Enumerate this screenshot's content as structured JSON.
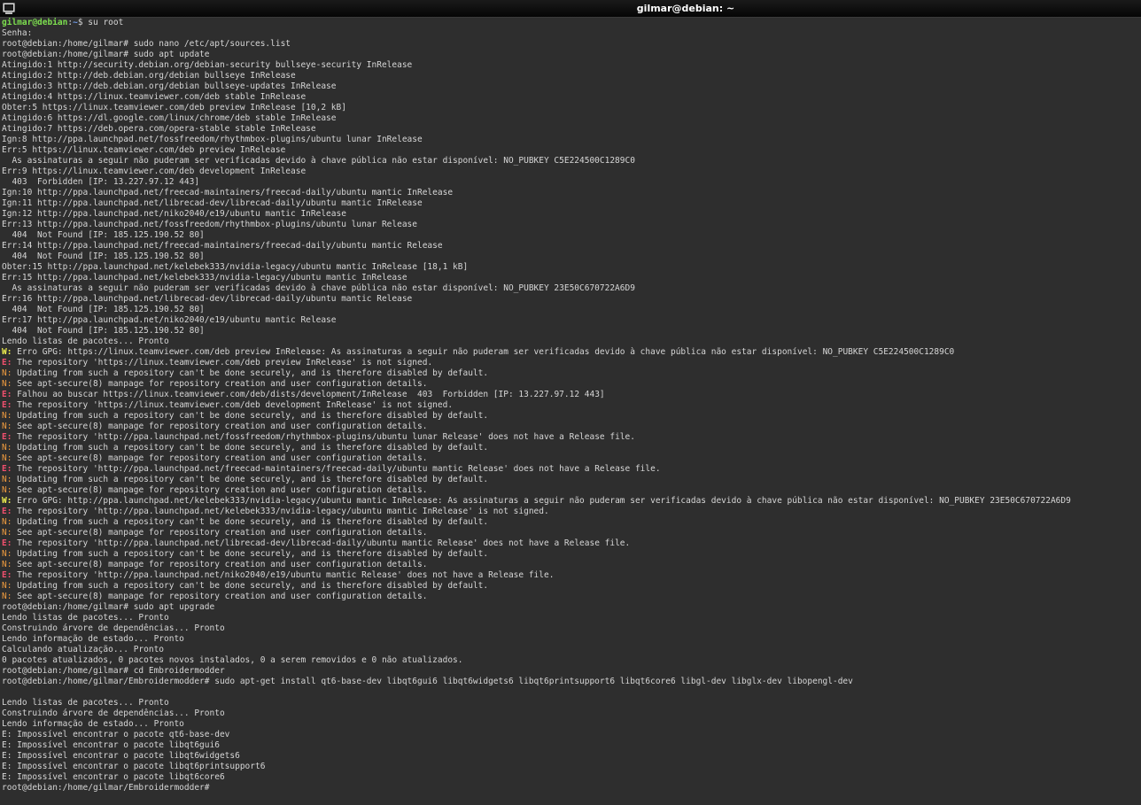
{
  "window": {
    "title": "gilmar@debian: ~"
  },
  "icons": {
    "app_icon": "terminal-icon"
  },
  "colors": {
    "background": "#2e2e2e",
    "text": "#d6d6d6",
    "prompt_user": "#7ddf4f",
    "prompt_path": "#6f9be8",
    "warning_prefix": "#f2f24f",
    "error_prefix": "#f0506e",
    "notice_prefix": "#ef9b3f"
  },
  "prompt": {
    "user_host": "gilmar@debian",
    "separator": ":",
    "path": "~",
    "symbol": "$ ",
    "command": "su root"
  },
  "lines": [
    {
      "t": "Senha:"
    },
    {
      "t": "root@debian:/home/gilmar# sudo nano /etc/apt/sources.list"
    },
    {
      "t": "root@debian:/home/gilmar# sudo apt update"
    },
    {
      "t": "Atingido:1 http://security.debian.org/debian-security bullseye-security InRelease"
    },
    {
      "t": "Atingido:2 http://deb.debian.org/debian bullseye InRelease"
    },
    {
      "t": "Atingido:3 http://deb.debian.org/debian bullseye-updates InRelease"
    },
    {
      "t": "Atingido:4 https://linux.teamviewer.com/deb stable InRelease"
    },
    {
      "t": "Obter:5 https://linux.teamviewer.com/deb preview InRelease [10,2 kB]"
    },
    {
      "t": "Atingido:6 https://dl.google.com/linux/chrome/deb stable InRelease"
    },
    {
      "t": "Atingido:7 https://deb.opera.com/opera-stable stable InRelease"
    },
    {
      "t": "Ign:8 http://ppa.launchpad.net/fossfreedom/rhythmbox-plugins/ubuntu lunar InRelease"
    },
    {
      "t": "Err:5 https://linux.teamviewer.com/deb preview InRelease"
    },
    {
      "t": "  As assinaturas a seguir não puderam ser verificadas devido à chave pública não estar disponível: NO_PUBKEY C5E224500C1289C0"
    },
    {
      "t": "Err:9 https://linux.teamviewer.com/deb development InRelease"
    },
    {
      "t": "  403  Forbidden [IP: 13.227.97.12 443]"
    },
    {
      "t": "Ign:10 http://ppa.launchpad.net/freecad-maintainers/freecad-daily/ubuntu mantic InRelease"
    },
    {
      "t": "Ign:11 http://ppa.launchpad.net/librecad-dev/librecad-daily/ubuntu mantic InRelease"
    },
    {
      "t": "Ign:12 http://ppa.launchpad.net/niko2040/e19/ubuntu mantic InRelease"
    },
    {
      "t": "Err:13 http://ppa.launchpad.net/fossfreedom/rhythmbox-plugins/ubuntu lunar Release"
    },
    {
      "t": "  404  Not Found [IP: 185.125.190.52 80]"
    },
    {
      "t": "Err:14 http://ppa.launchpad.net/freecad-maintainers/freecad-daily/ubuntu mantic Release"
    },
    {
      "t": "  404  Not Found [IP: 185.125.190.52 80]"
    },
    {
      "t": "Obter:15 http://ppa.launchpad.net/kelebek333/nvidia-legacy/ubuntu mantic InRelease [18,1 kB]"
    },
    {
      "t": "Err:15 http://ppa.launchpad.net/kelebek333/nvidia-legacy/ubuntu mantic InRelease"
    },
    {
      "t": "  As assinaturas a seguir não puderam ser verificadas devido à chave pública não estar disponível: NO_PUBKEY 23E50C670722A6D9"
    },
    {
      "t": "Err:16 http://ppa.launchpad.net/librecad-dev/librecad-daily/ubuntu mantic Release"
    },
    {
      "t": "  404  Not Found [IP: 185.125.190.52 80]"
    },
    {
      "t": "Err:17 http://ppa.launchpad.net/niko2040/e19/ubuntu mantic Release"
    },
    {
      "t": "  404  Not Found [IP: 185.125.190.52 80]"
    },
    {
      "t": "Lendo listas de pacotes... Pronto"
    },
    {
      "p": "W:",
      "k": "w",
      "t": " Erro GPG: https://linux.teamviewer.com/deb preview InRelease: As assinaturas a seguir não puderam ser verificadas devido à chave pública não estar disponível: NO_PUBKEY C5E224500C1289C0"
    },
    {
      "p": "E:",
      "k": "e",
      "t": " The repository 'https://linux.teamviewer.com/deb preview InRelease' is not signed."
    },
    {
      "p": "N:",
      "k": "n",
      "t": " Updating from such a repository can't be done securely, and is therefore disabled by default."
    },
    {
      "p": "N:",
      "k": "n",
      "t": " See apt-secure(8) manpage for repository creation and user configuration details."
    },
    {
      "p": "E:",
      "k": "e",
      "t": " Falhou ao buscar https://linux.teamviewer.com/deb/dists/development/InRelease  403  Forbidden [IP: 13.227.97.12 443]"
    },
    {
      "p": "E:",
      "k": "e",
      "t": " The repository 'https://linux.teamviewer.com/deb development InRelease' is not signed."
    },
    {
      "p": "N:",
      "k": "n",
      "t": " Updating from such a repository can't be done securely, and is therefore disabled by default."
    },
    {
      "p": "N:",
      "k": "n",
      "t": " See apt-secure(8) manpage for repository creation and user configuration details."
    },
    {
      "p": "E:",
      "k": "e",
      "t": " The repository 'http://ppa.launchpad.net/fossfreedom/rhythmbox-plugins/ubuntu lunar Release' does not have a Release file."
    },
    {
      "p": "N:",
      "k": "n",
      "t": " Updating from such a repository can't be done securely, and is therefore disabled by default."
    },
    {
      "p": "N:",
      "k": "n",
      "t": " See apt-secure(8) manpage for repository creation and user configuration details."
    },
    {
      "p": "E:",
      "k": "e",
      "t": " The repository 'http://ppa.launchpad.net/freecad-maintainers/freecad-daily/ubuntu mantic Release' does not have a Release file."
    },
    {
      "p": "N:",
      "k": "n",
      "t": " Updating from such a repository can't be done securely, and is therefore disabled by default."
    },
    {
      "p": "N:",
      "k": "n",
      "t": " See apt-secure(8) manpage for repository creation and user configuration details."
    },
    {
      "p": "W:",
      "k": "w",
      "t": " Erro GPG: http://ppa.launchpad.net/kelebek333/nvidia-legacy/ubuntu mantic InRelease: As assinaturas a seguir não puderam ser verificadas devido à chave pública não estar disponível: NO_PUBKEY 23E50C670722A6D9"
    },
    {
      "p": "E:",
      "k": "e",
      "t": " The repository 'http://ppa.launchpad.net/kelebek333/nvidia-legacy/ubuntu mantic InRelease' is not signed."
    },
    {
      "p": "N:",
      "k": "n",
      "t": " Updating from such a repository can't be done securely, and is therefore disabled by default."
    },
    {
      "p": "N:",
      "k": "n",
      "t": " See apt-secure(8) manpage for repository creation and user configuration details."
    },
    {
      "p": "E:",
      "k": "e",
      "t": " The repository 'http://ppa.launchpad.net/librecad-dev/librecad-daily/ubuntu mantic Release' does not have a Release file."
    },
    {
      "p": "N:",
      "k": "n",
      "t": " Updating from such a repository can't be done securely, and is therefore disabled by default."
    },
    {
      "p": "N:",
      "k": "n",
      "t": " See apt-secure(8) manpage for repository creation and user configuration details."
    },
    {
      "p": "E:",
      "k": "e",
      "t": " The repository 'http://ppa.launchpad.net/niko2040/e19/ubuntu mantic Release' does not have a Release file."
    },
    {
      "p": "N:",
      "k": "n",
      "t": " Updating from such a repository can't be done securely, and is therefore disabled by default."
    },
    {
      "p": "N:",
      "k": "n",
      "t": " See apt-secure(8) manpage for repository creation and user configuration details."
    },
    {
      "t": "root@debian:/home/gilmar# sudo apt upgrade"
    },
    {
      "t": "Lendo listas de pacotes... Pronto"
    },
    {
      "t": "Construindo árvore de dependências... Pronto"
    },
    {
      "t": "Lendo informação de estado... Pronto"
    },
    {
      "t": "Calculando atualização... Pronto"
    },
    {
      "t": "0 pacotes atualizados, 0 pacotes novos instalados, 0 a serem removidos e 0 não atualizados."
    },
    {
      "t": "root@debian:/home/gilmar# cd Embroidermodder"
    },
    {
      "t": "root@debian:/home/gilmar/Embroidermodder# sudo apt-get install qt6-base-dev libqt6gui6 libqt6widgets6 libqt6printsupport6 libqt6core6 libgl-dev libglx-dev libopengl-dev"
    },
    {
      "t": ""
    },
    {
      "t": "Lendo listas de pacotes... Pronto"
    },
    {
      "t": "Construindo árvore de dependências... Pronto"
    },
    {
      "t": "Lendo informação de estado... Pronto"
    },
    {
      "t": "E: Impossível encontrar o pacote qt6-base-dev"
    },
    {
      "t": "E: Impossível encontrar o pacote libqt6gui6"
    },
    {
      "t": "E: Impossível encontrar o pacote libqt6widgets6"
    },
    {
      "t": "E: Impossível encontrar o pacote libqt6printsupport6"
    },
    {
      "t": "E: Impossível encontrar o pacote libqt6core6"
    },
    {
      "t": "root@debian:/home/gilmar/Embroidermodder#"
    }
  ]
}
